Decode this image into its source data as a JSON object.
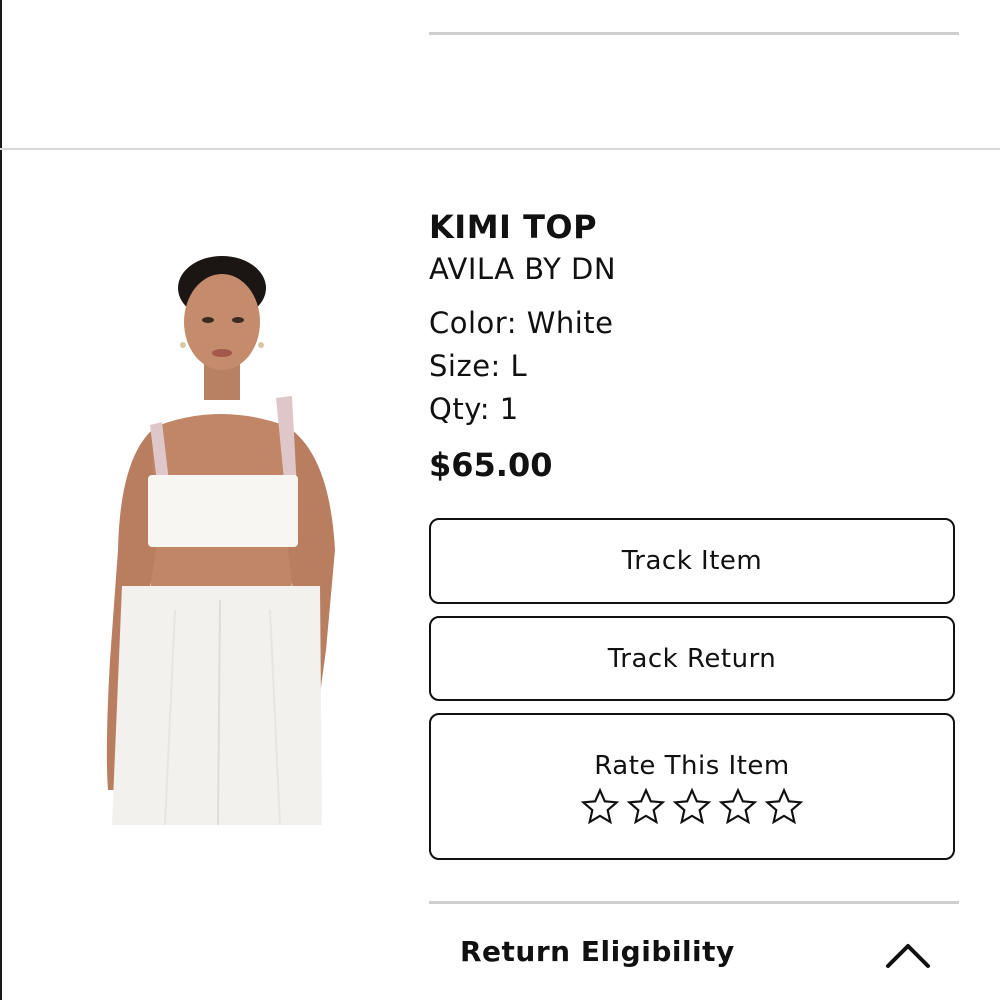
{
  "product": {
    "name": "KIMI TOP",
    "brand": "AVILA BY DN",
    "color": "Color: White",
    "size": "Size: L",
    "qty": "Qty: 1",
    "price": "$65.00"
  },
  "actions": {
    "track_item": "Track Item",
    "track_return": "Track Return",
    "rate_label": "Rate This Item",
    "rating": {
      "current": 0,
      "max": 5,
      "icon": "star-outline-icon"
    }
  },
  "return_section": {
    "label": "Return Eligibility",
    "icon": "chevron-up-icon"
  },
  "colors": {
    "text": "#111111",
    "divider": "#cfcfcf",
    "background": "#ffffff"
  }
}
